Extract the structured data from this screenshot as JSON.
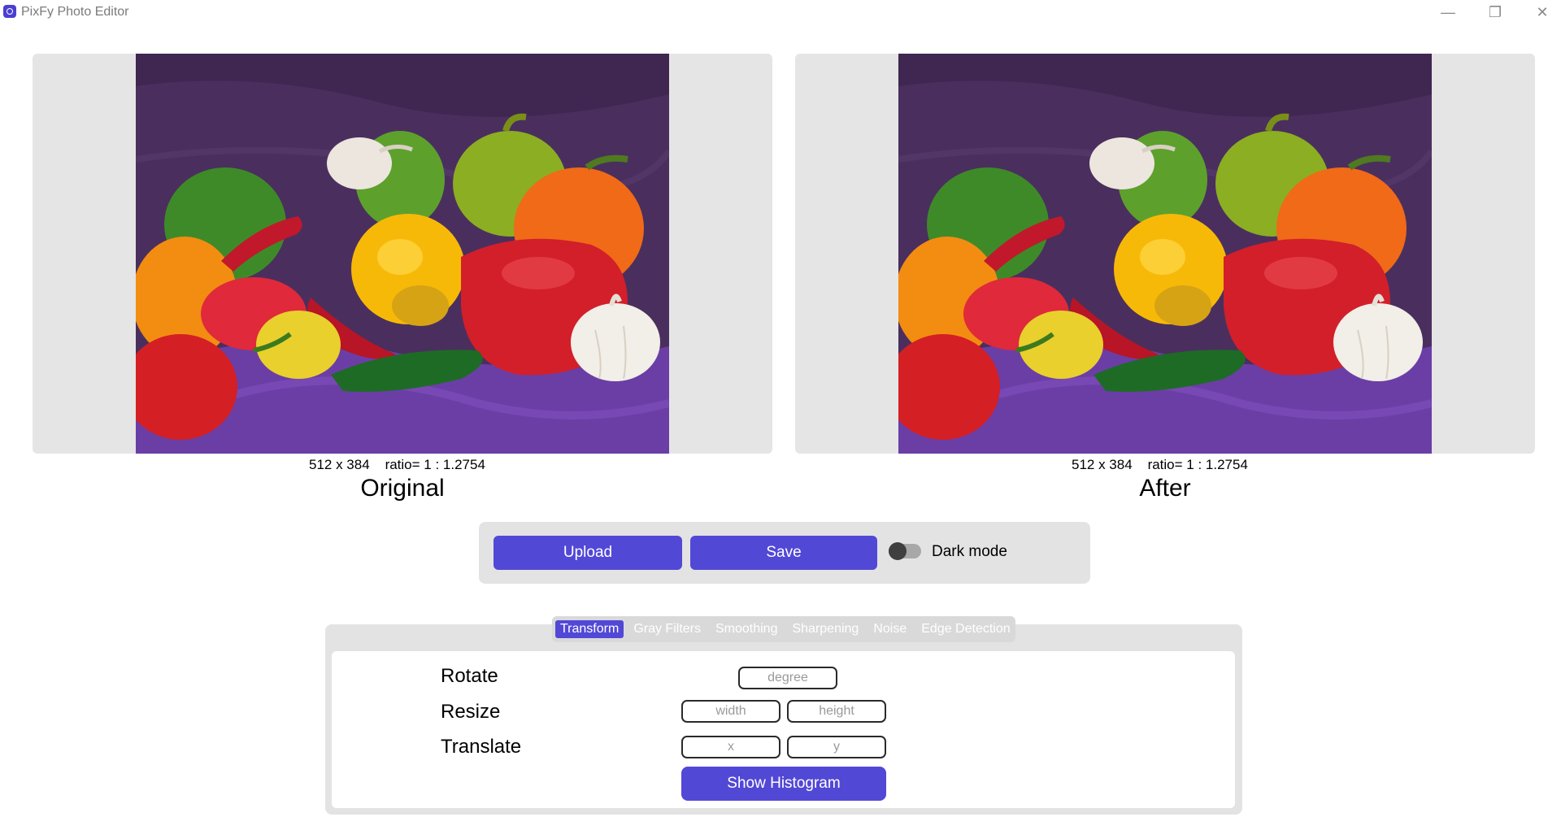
{
  "window": {
    "title": "PixFy Photo Editor",
    "controls": {
      "minimize": "—",
      "restore": "❐",
      "close": "✕"
    }
  },
  "images": {
    "original": {
      "dims": "512 x 384    ratio= 1 : 1.2754",
      "caption": "Original"
    },
    "after": {
      "dims": "512 x 384    ratio= 1 : 1.2754",
      "caption": "After"
    }
  },
  "actions": {
    "upload_label": "Upload",
    "save_label": "Save",
    "dark_mode_label": "Dark mode",
    "dark_mode_on": false
  },
  "tabs": [
    {
      "label": "Transform",
      "active": true
    },
    {
      "label": "Gray Filters",
      "active": false
    },
    {
      "label": "Smoothing",
      "active": false
    },
    {
      "label": "Sharpening",
      "active": false
    },
    {
      "label": "Noise",
      "active": false
    },
    {
      "label": "Edge Detection",
      "active": false
    }
  ],
  "transform": {
    "rotate": {
      "label": "Rotate",
      "placeholder": "degree"
    },
    "resize": {
      "label": "Resize",
      "width_placeholder": "width",
      "height_placeholder": "height"
    },
    "translate": {
      "label": "Translate",
      "x_placeholder": "x",
      "y_placeholder": "y"
    },
    "histogram_label": "Show Histogram"
  },
  "colors": {
    "accent": "#5248d6",
    "panel_bg": "#e5e5e5",
    "backdrop_purple": "#4a2f5e"
  }
}
